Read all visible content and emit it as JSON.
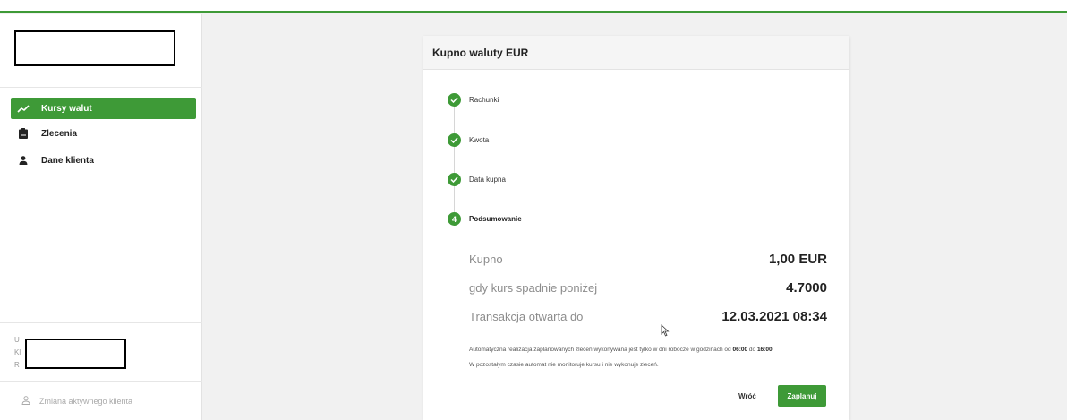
{
  "colors": {
    "brand_green": "#3e9a37"
  },
  "sidebar": {
    "items": [
      {
        "label": "Kursy walut",
        "icon": "trending-up-icon",
        "active": true
      },
      {
        "label": "Zlecenia",
        "icon": "clipboard-icon",
        "active": false
      },
      {
        "label": "Dane klienta",
        "icon": "person-icon",
        "active": false
      }
    ],
    "user_info_lines": [
      "U",
      "Kl",
      "R"
    ],
    "change_client_label": "Zmiana aktywnego klienta",
    "change_client_icon": "person-outline-icon"
  },
  "card": {
    "title": "Kupno waluty EUR",
    "steps": [
      {
        "label": "Rachunki",
        "state": "done"
      },
      {
        "label": "Kwota",
        "state": "done"
      },
      {
        "label": "Data kupna",
        "state": "done"
      },
      {
        "label": "Podsumowanie",
        "state": "current",
        "number": "4"
      }
    ],
    "summary": [
      {
        "label": "Kupno",
        "value": "1,00 EUR"
      },
      {
        "label": "gdy kurs spadnie poniżej",
        "value": "4.7000"
      },
      {
        "label": "Transakcja otwarta do",
        "value": "12.03.2021 08:34"
      }
    ],
    "note": {
      "line1_a": "Automatyczna realizacja zaplanowanych zleceń wykonywana jest tylko w dni robocze w godzinach od ",
      "time_from": "06:00",
      "line1_b": " do ",
      "time_to": "16:00",
      "line1_c": ".",
      "line2": "W pozostałym czasie automat nie monitoruje kursu i nie wykonuje zleceń."
    },
    "back_label": "Wróć",
    "plan_label": "Zaplanuj"
  }
}
